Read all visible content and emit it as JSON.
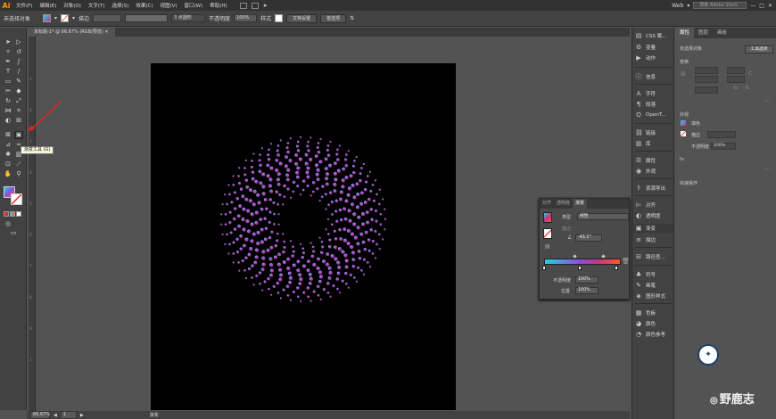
{
  "app": {
    "logo": "Ai",
    "menus": [
      "文件(F)",
      "编辑(E)",
      "对象(O)",
      "文字(T)",
      "选择(S)",
      "效果(C)",
      "视图(V)",
      "窗口(W)",
      "帮助(H)"
    ],
    "workspace": "Web",
    "search_placeholder": "搜索 Adobe Stock"
  },
  "control_bar": {
    "selection_label": "未选择对象",
    "stroke_label": "描边",
    "stroke_value": "",
    "brush_label": "3 点圆形",
    "opacity_label": "不透明度",
    "opacity_value": "100%",
    "style_label": "样式",
    "doc_settings_button": "文档设置",
    "prefs_button": "首选项"
  },
  "document": {
    "tab_title": "未标题-1* @ 66.67% (RGB/预览)"
  },
  "ruler_v_ticks": [
    "1",
    "2",
    "3",
    "4",
    "5",
    "6",
    "7",
    "8",
    "9",
    "1"
  ],
  "tooltip": "渐变工具 (G)",
  "status_bar": {
    "zoom": "66.67%",
    "page": "1",
    "mode": "渐变"
  },
  "dock": {
    "items": [
      {
        "icon": "css-icon",
        "label": "CSS 属..."
      },
      {
        "icon": "variables-icon",
        "label": "变量"
      },
      {
        "icon": "actions-icon",
        "label": "动作"
      },
      {
        "icon": "info-icon",
        "label": "信息"
      },
      {
        "icon": "character-icon",
        "label": "字符"
      },
      {
        "icon": "paragraph-icon",
        "label": "段落"
      },
      {
        "icon": "opentype-icon",
        "label": "OpenT..."
      },
      {
        "icon": "links-icon",
        "label": "链接"
      },
      {
        "icon": "libraries-icon",
        "label": "库"
      },
      {
        "icon": "properties-icon",
        "label": "属性"
      },
      {
        "icon": "appearance-icon",
        "label": "外观"
      },
      {
        "icon": "export-icon",
        "label": "资源导出"
      },
      {
        "icon": "align-icon",
        "label": "对齐"
      },
      {
        "icon": "transparency-icon",
        "label": "透明度"
      },
      {
        "icon": "gradient-icon",
        "label": "渐变"
      },
      {
        "icon": "stroke-icon",
        "label": "描边"
      },
      {
        "icon": "pathfinder-icon",
        "label": "路径查..."
      },
      {
        "icon": "symbols-icon",
        "label": "符号"
      },
      {
        "icon": "brushes-icon",
        "label": "画笔"
      },
      {
        "icon": "graphic-styles-icon",
        "label": "图形样式"
      },
      {
        "icon": "swatches-icon",
        "label": "色板"
      },
      {
        "icon": "color-icon",
        "label": "颜色"
      },
      {
        "icon": "color-guide-icon",
        "label": "颜色参考"
      }
    ]
  },
  "properties_panel": {
    "tabs": [
      "属性",
      "图层",
      "画板"
    ],
    "no_selection": "未选择对象",
    "tool_options_button": "工具选项",
    "transform_label": "变换",
    "appearance_label": "外观",
    "fill_label": "填色",
    "stroke_label": "描边",
    "opacity_label": "不透明度",
    "opacity_value": "100%",
    "fx_label": "fx.",
    "quick_actions_label": "快速操作"
  },
  "gradient_panel": {
    "tabs": [
      "对齐",
      "透明度",
      "渐变"
    ],
    "type_label": "类型",
    "type_value": "线性",
    "stroke_label": "描边",
    "angle_value": "-43.1°",
    "opacity_label": "不透明度",
    "opacity_value": "100%",
    "location_label": "位置",
    "location_value": "100%",
    "colors": {
      "start": "#1fd4e0",
      "mid": "#8a4fe0",
      "end": "#ff5a2a"
    }
  },
  "watermark": {
    "text": "野鹿志"
  }
}
